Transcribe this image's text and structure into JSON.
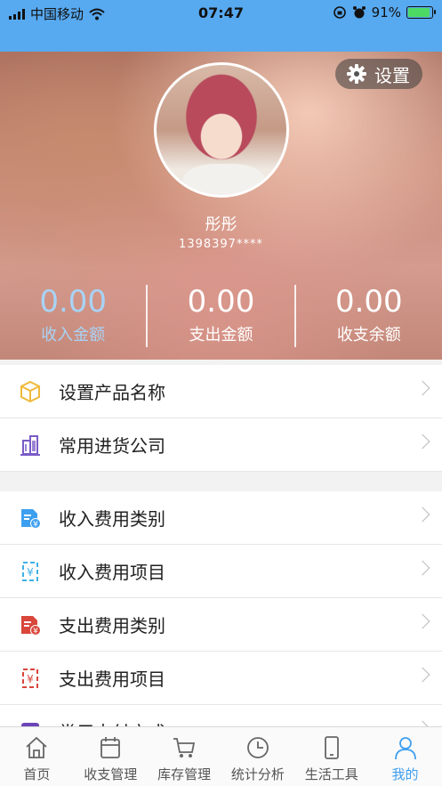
{
  "status_bar": {
    "carrier": "中国移动",
    "time": "07:47",
    "battery": "91%"
  },
  "profile": {
    "settings_label": "设置",
    "name": "彤彤",
    "phone": "1398397****"
  },
  "stats": [
    {
      "value": "0.00",
      "label": "收入金额"
    },
    {
      "value": "0.00",
      "label": "支出金额"
    },
    {
      "value": "0.00",
      "label": "收支余额"
    }
  ],
  "menu": {
    "group1": [
      {
        "label": "设置产品名称",
        "icon": "box-icon"
      },
      {
        "label": "常用进货公司",
        "icon": "building-icon"
      }
    ],
    "group2": [
      {
        "label": "收入费用类别",
        "icon": "income-category-icon"
      },
      {
        "label": "收入费用项目",
        "icon": "income-item-icon"
      },
      {
        "label": "支出费用类别",
        "icon": "expense-category-icon"
      },
      {
        "label": "支出费用项目",
        "icon": "expense-item-icon"
      },
      {
        "label": "常用支付方式",
        "icon": "payment-icon"
      }
    ]
  },
  "tabs": [
    {
      "label": "首页",
      "icon": "home-icon"
    },
    {
      "label": "收支管理",
      "icon": "calendar-icon"
    },
    {
      "label": "库存管理",
      "icon": "cart-icon"
    },
    {
      "label": "统计分析",
      "icon": "clock-icon"
    },
    {
      "label": "生活工具",
      "icon": "phone-icon"
    },
    {
      "label": "我的",
      "icon": "user-icon",
      "active": true
    }
  ],
  "colors": {
    "accent": "#3e9ff0",
    "status_bar": "#57a9f0",
    "income_stat": "#a9d3f5"
  }
}
